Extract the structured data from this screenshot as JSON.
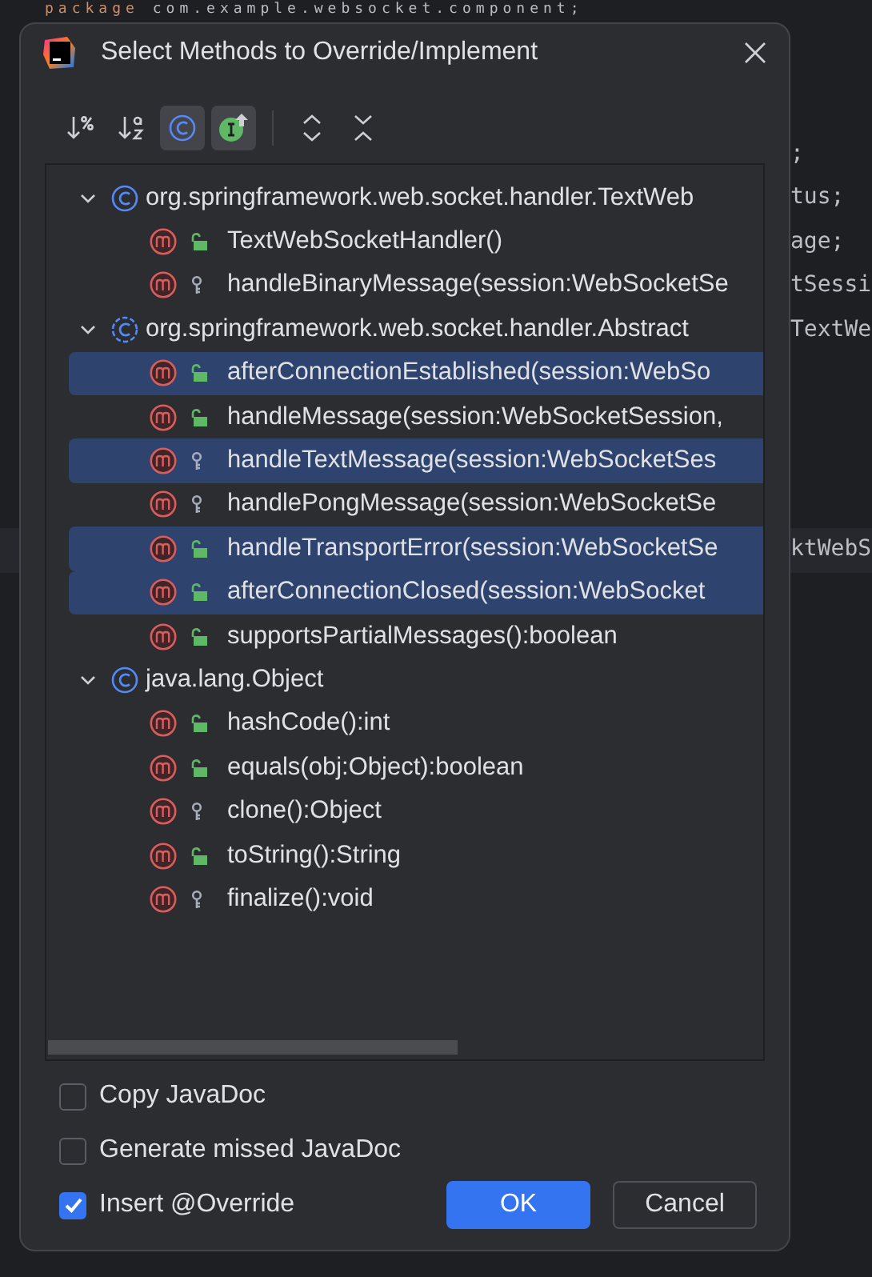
{
  "editor": {
    "lines": [
      {
        "current": false,
        "tokens": [
          {
            "text": "package",
            "kind": "keyword"
          },
          {
            "text": " com.example.websocket.component;",
            "kind": "plain"
          }
        ]
      },
      {
        "current": false,
        "tokens": [
          {
            "text": ";",
            "kind": "plain"
          }
        ]
      },
      {
        "current": false,
        "tokens": [
          {
            "text": "tus;",
            "kind": "plain"
          }
        ]
      },
      {
        "current": false,
        "tokens": [
          {
            "text": "age;",
            "kind": "plain"
          }
        ]
      },
      {
        "current": false,
        "tokens": [
          {
            "text": "tSessi",
            "kind": "plain"
          }
        ]
      },
      {
        "current": false,
        "tokens": [
          {
            "text": "TextWe",
            "kind": "plain"
          }
        ]
      },
      {
        "current": true,
        "tokens": [
          {
            "text": "ktWebS",
            "kind": "plain"
          }
        ]
      }
    ]
  },
  "dialog": {
    "title": "Select Methods to Override/Implement",
    "toolbar": [
      {
        "kind": "sort_percent",
        "selected": false
      },
      {
        "kind": "sort_alpha",
        "selected": false
      },
      {
        "kind": "show_classes",
        "selected": true
      },
      {
        "kind": "show_interfaces",
        "selected": true
      },
      {
        "kind": "separator"
      },
      {
        "kind": "expand_all"
      },
      {
        "kind": "collapse_all"
      }
    ],
    "tree": [
      {
        "name": "org.springframework.web.socket.handler.TextWeb",
        "kind": "class",
        "expanded": true,
        "methods": [
          {
            "name": "TextWebSocketHandler()",
            "kind": "public",
            "selected": false
          },
          {
            "name": "handleBinaryMessage(session:WebSocketSe",
            "kind": "protected",
            "selected": false
          }
        ]
      },
      {
        "name": "org.springframework.web.socket.handler.Abstract",
        "kind": "abstract_class",
        "expanded": true,
        "methods": [
          {
            "name": "afterConnectionEstablished(session:WebSo",
            "kind": "public",
            "selected": true
          },
          {
            "name": "handleMessage(session:WebSocketSession,",
            "kind": "public",
            "selected": false
          },
          {
            "name": "handleTextMessage(session:WebSocketSes",
            "kind": "protected",
            "selected": true
          },
          {
            "name": "handlePongMessage(session:WebSocketSe",
            "kind": "protected",
            "selected": false
          },
          {
            "name": "handleTransportError(session:WebSocketSe",
            "kind": "public",
            "selected": true
          },
          {
            "name": "afterConnectionClosed(session:WebSocket",
            "kind": "public",
            "selected": true
          },
          {
            "name": "supportsPartialMessages():boolean",
            "kind": "public",
            "selected": false
          }
        ]
      },
      {
        "name": "java.lang.Object",
        "kind": "class",
        "expanded": true,
        "methods": [
          {
            "name": "hashCode():int",
            "kind": "public",
            "selected": false
          },
          {
            "name": "equals(obj:Object):boolean",
            "kind": "public",
            "selected": false
          },
          {
            "name": "clone():Object",
            "kind": "protected",
            "selected": false
          },
          {
            "name": "toString():String",
            "kind": "public",
            "selected": false
          },
          {
            "name": "finalize():void",
            "kind": "protected",
            "selected": false
          }
        ]
      }
    ],
    "options": [
      {
        "label": "Copy JavaDoc",
        "checked": false
      },
      {
        "label": "Generate missed JavaDoc",
        "checked": false
      },
      {
        "label": "Insert @Override",
        "checked": true
      }
    ],
    "buttons": [
      {
        "label": "OK",
        "kind": "primary"
      },
      {
        "label": "Cancel",
        "kind": "secondary"
      }
    ]
  }
}
